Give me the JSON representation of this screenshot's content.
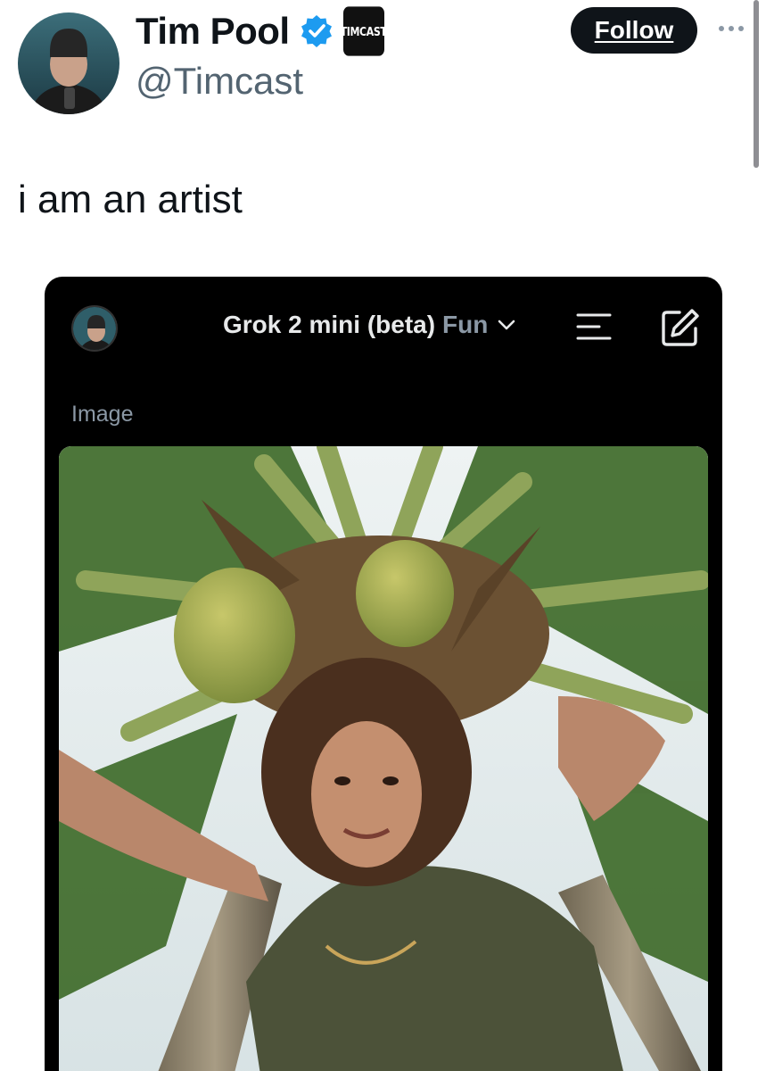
{
  "author": {
    "display_name": "Tim Pool",
    "handle": "@Timcast",
    "affiliate_badge": "TIMCAST"
  },
  "follow_label": "Follow",
  "tweet_text": "i am an artist",
  "grok_card": {
    "model_name": "Grok 2 mini (beta)",
    "mode": "Fun",
    "section_label": "Image"
  },
  "colors": {
    "verified": "#1d9bf0",
    "follow_bg": "#0f1419",
    "card_bg": "#000000",
    "secondary_text": "#536471"
  },
  "icons": [
    "verified-icon",
    "more-icon",
    "chevron-down-icon",
    "menu-icon",
    "edit-icon"
  ]
}
